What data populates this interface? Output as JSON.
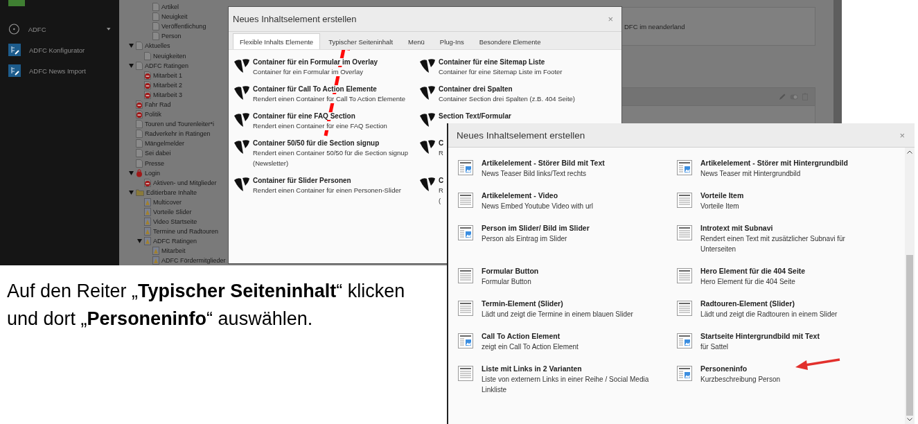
{
  "backend": {
    "module_menu": [
      {
        "label": "ADFC",
        "kind": "group"
      },
      {
        "label": "ADFC Konfigurator",
        "kind": "module"
      },
      {
        "label": "ADFC News Import",
        "kind": "module"
      }
    ],
    "tree": {
      "orphans": [
        {
          "label": "Artikel",
          "kind": "page",
          "expanded": false
        },
        {
          "label": "Neuigkeit",
          "kind": "page",
          "expanded": false
        },
        {
          "label": "Veröffentlichung",
          "kind": "page",
          "expanded": false
        },
        {
          "label": "Person",
          "kind": "page",
          "expanded": false
        }
      ],
      "items": [
        {
          "label": "Aktuelles",
          "kind": "page",
          "expanded": true,
          "children": [
            {
              "label": "Neuigkeiten",
              "kind": "page",
              "expanded": false
            }
          ]
        },
        {
          "label": "ADFC Ratingen",
          "kind": "page",
          "expanded": true,
          "children": [
            {
              "label": "Mitarbeit 1",
              "kind": "hidden",
              "expanded": false
            },
            {
              "label": "Mitarbeit 2",
              "kind": "hidden",
              "expanded": false
            },
            {
              "label": "Mitarbeit 3",
              "kind": "hidden",
              "expanded": false
            }
          ]
        },
        {
          "label": "Fahr Rad",
          "kind": "hidden",
          "expanded": false
        },
        {
          "label": "Politik",
          "kind": "hidden",
          "expanded": false
        },
        {
          "label": "Touren und Tourenleiter*i",
          "kind": "page",
          "expanded": false
        },
        {
          "label": "Radverkehr in Ratingen",
          "kind": "page",
          "expanded": false
        },
        {
          "label": "Mängelmelder",
          "kind": "page",
          "expanded": false
        },
        {
          "label": "Sei dabei",
          "kind": "page",
          "expanded": false
        },
        {
          "label": "Presse",
          "kind": "page",
          "expanded": false
        },
        {
          "label": "Login",
          "kind": "login",
          "expanded": true,
          "children": [
            {
              "label": "Aktiven- und Mitglieder",
              "kind": "hidden",
              "expanded": false
            }
          ]
        },
        {
          "label": "Editierbare Inhalte",
          "kind": "folder",
          "expanded": true,
          "children": [
            {
              "label": "Multicover",
              "kind": "record",
              "expanded": false
            },
            {
              "label": "Vorteile Slider",
              "kind": "record",
              "expanded": false
            },
            {
              "label": "Video Startseite",
              "kind": "record",
              "expanded": false
            },
            {
              "label": "Termine und Radtouren",
              "kind": "record",
              "expanded": false
            },
            {
              "label": "ADFC Ratingen",
              "kind": "record",
              "expanded": true,
              "children": [
                {
                  "label": "Mitarbeit",
                  "kind": "record",
                  "expanded": false
                },
                {
                  "label": "ADFC Fördermitglieder",
                  "kind": "record",
                  "expanded": false
                }
              ]
            }
          ]
        }
      ]
    },
    "content": {
      "text": "DFC im neanderland"
    }
  },
  "dialog_1": {
    "title": "Neues Inhaltselement erstellen",
    "close": "×",
    "tabs": [
      {
        "label": "Flexible Inhalts Elemente",
        "selected": true
      },
      {
        "label": "Typischer Seiteninhalt",
        "selected": false
      },
      {
        "label": "Menü",
        "selected": false
      },
      {
        "label": "Plug-Ins",
        "selected": false
      },
      {
        "label": "Besondere Elemente",
        "selected": false
      }
    ],
    "elements": [
      {
        "title": "Container für ein Formular im Overlay",
        "description_lines": [
          "Container für ein Formular im Overlay"
        ]
      },
      {
        "title": "Container für eine Sitemap Liste",
        "description_lines": [
          "Container für eine Sitemap Liste im Footer"
        ]
      },
      {
        "title": "Container für Call To Action Elemente",
        "description_lines": [
          "Rendert einen Container für Call To Action Elemente"
        ]
      },
      {
        "title": "Container drei Spalten",
        "description_lines": [
          "Container Section drei Spalten (z.B. 404 Seite)"
        ]
      },
      {
        "title": "Container für eine FAQ Section",
        "description_lines": [
          "Rendert einen Container für eine FAQ Section"
        ]
      },
      {
        "title": "Section Text/Formular"
      },
      {
        "title": "Container 50/50 für die Section signup",
        "description_lines": [
          "Rendert einen Container 50/50 für die Section signup",
          "(Newsletter)"
        ]
      },
      {
        "title": "C",
        "description_lines": [
          "R"
        ]
      },
      {
        "title": "Container für Slider Personen",
        "description_lines": [
          "Rendert einen Container für einen Personen-Slider"
        ]
      },
      {
        "title": "C",
        "description_lines": [
          "R",
          "("
        ]
      }
    ]
  },
  "dialog_2": {
    "title": "Neues Inhaltselement erstellen",
    "close": "×",
    "elements": [
      {
        "title": "Artikelelement - Störer Bild mit Text",
        "description": "News Teaser Bild links/Text rechts",
        "kind": "image"
      },
      {
        "title": "Artikelelement - Störer mit Hintergrundbild",
        "description": "News Teaser mit Hintergrundbild",
        "kind": "image"
      },
      {
        "title": "Artikelelement - Video",
        "description": "News Embed Youtube Video with url",
        "kind": "text"
      },
      {
        "title": "Vorteile Item",
        "description": "Vorteile Item",
        "kind": "text"
      },
      {
        "title": "Person im Slider/ Bild im Slider",
        "description": "Person als Eintrag im Slider",
        "kind": "image"
      },
      {
        "title": "Introtext mit Subnavi",
        "description": "Rendert einen Text mit zusätzlicher Subnavi für Unterseiten",
        "kind": "text"
      },
      {
        "title": "Formular Button",
        "description": "Formular Button",
        "kind": "text"
      },
      {
        "title": "Hero Element für die 404 Seite",
        "description": "Hero Element für die 404 Seite",
        "kind": "text"
      },
      {
        "title": "Termin-Element (Slider)",
        "description": "Lädt und zeigt die Termine in einem blauen Slider",
        "kind": "text"
      },
      {
        "title": "Radtouren-Element (Slider)",
        "description": "Lädt und zeigt die Radtouren in einem Slider",
        "kind": "text"
      },
      {
        "title": "Call To Action Element",
        "description": "zeigt ein Call To Action Element",
        "kind": "image"
      },
      {
        "title": "Startseite Hintergrundbild mit Text",
        "description": "für Sattel",
        "kind": "image"
      },
      {
        "title": "Liste mit Links in 2 Varianten",
        "description": "Liste von externern Links in einer Reihe / Social Media Linkliste",
        "kind": "text"
      },
      {
        "title": "Personeninfo",
        "description": "Kurzbeschreibung Person",
        "kind": "image"
      }
    ]
  },
  "instruction": "Auf den Reiter „**Typischer Seiteninhalt**“ klicken und dort „**Personeninfo**“ auswählen."
}
